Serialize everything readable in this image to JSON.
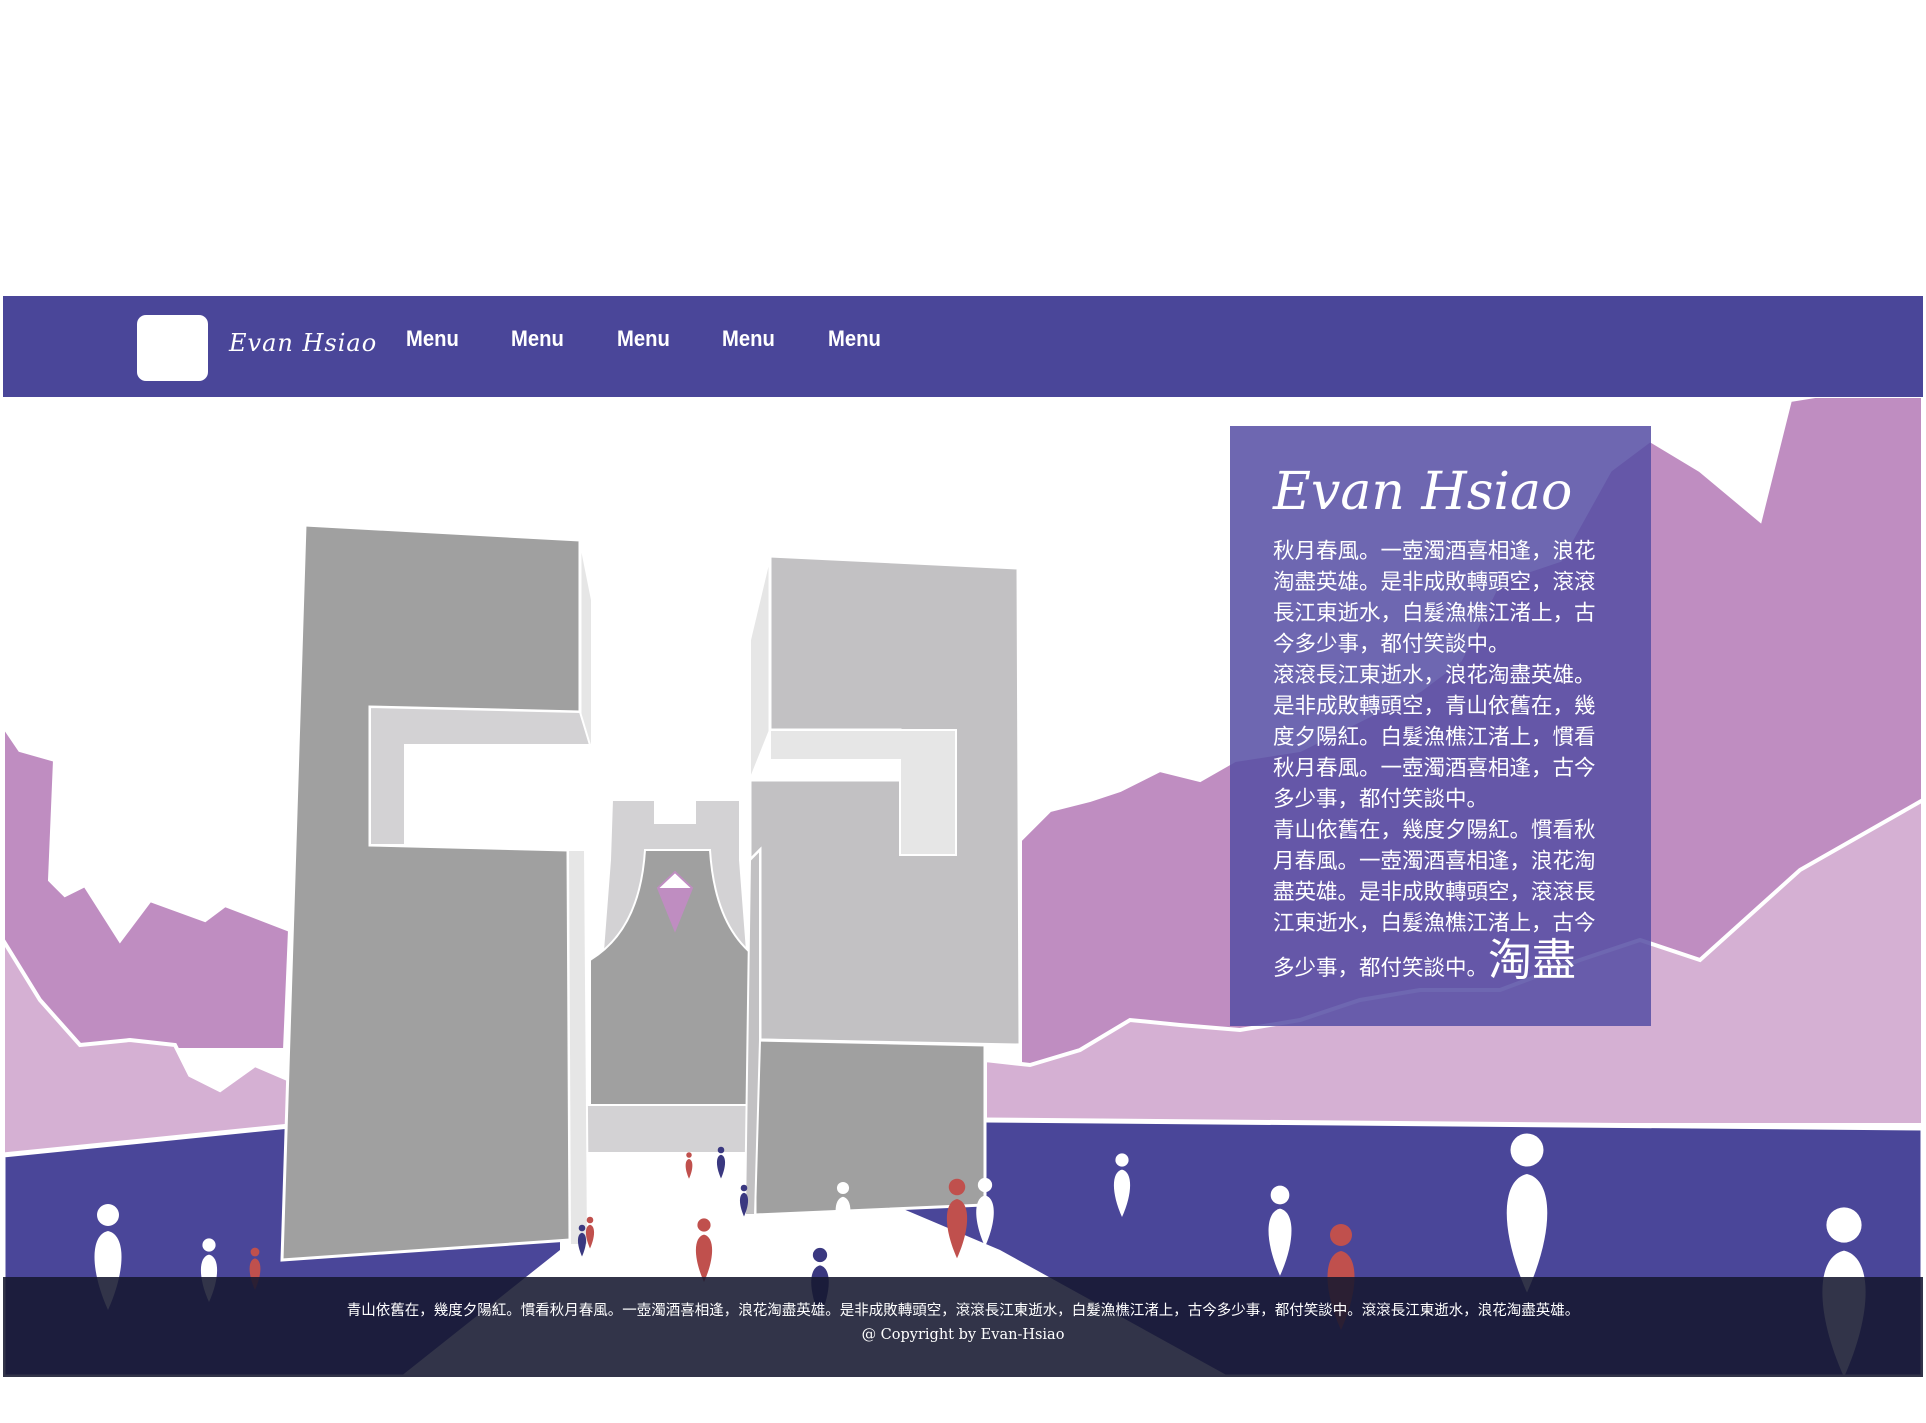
{
  "header": {
    "brand": "Evan Hsiao",
    "menu": [
      "Menu",
      "Menu",
      "Menu",
      "Menu",
      "Menu"
    ]
  },
  "intro": {
    "title": "Evan Hsiao",
    "body": "秋月春風。一壺濁酒喜相逢，浪花淘盡英雄。是非成敗轉頭空，滾滾長江東逝水，白髮漁樵江渚上，古今多少事，都付笑談中。\n滾滾長江東逝水，浪花淘盡英雄。是非成敗轉頭空，青山依舊在，幾度夕陽紅。白髮漁樵江渚上，慣看秋月春風。一壺濁酒喜相逢，古今多少事，都付笑談中。\n青山依舊在，幾度夕陽紅。慣看秋月春風。一壺濁酒喜相逢，浪花淘盡英雄。是非成敗轉頭空，滾滾長江東逝水，白髮漁樵江渚上，古今多少事，都付笑談中。",
    "emphasis": "淘盡"
  },
  "footer": {
    "text": "青山依舊在，幾度夕陽紅。慣看秋月春風。一壺濁酒喜相逢，浪花淘盡英雄。是非成敗轉頭空，滾滾長江東逝水，白髮漁樵江渚上，古今多少事，都付笑談中。滾滾長江東逝水，浪花淘盡英雄。",
    "copyright": "@ Copyright by Evan-Hsiao"
  },
  "colors": {
    "nav": "#4a4699",
    "mountain_back": "#bf8dc1",
    "mountain_front": "#d5b0d3",
    "ground": "#4a4699",
    "building": "#a0a0a0",
    "footer": "#1c1e3a",
    "person_red": "#c0504d",
    "person_navy": "#3a3880"
  },
  "icons": {
    "logo": "logo-placeholder-icon",
    "person": "person-figure-icon",
    "emblem": "diamond-emblem-icon"
  }
}
